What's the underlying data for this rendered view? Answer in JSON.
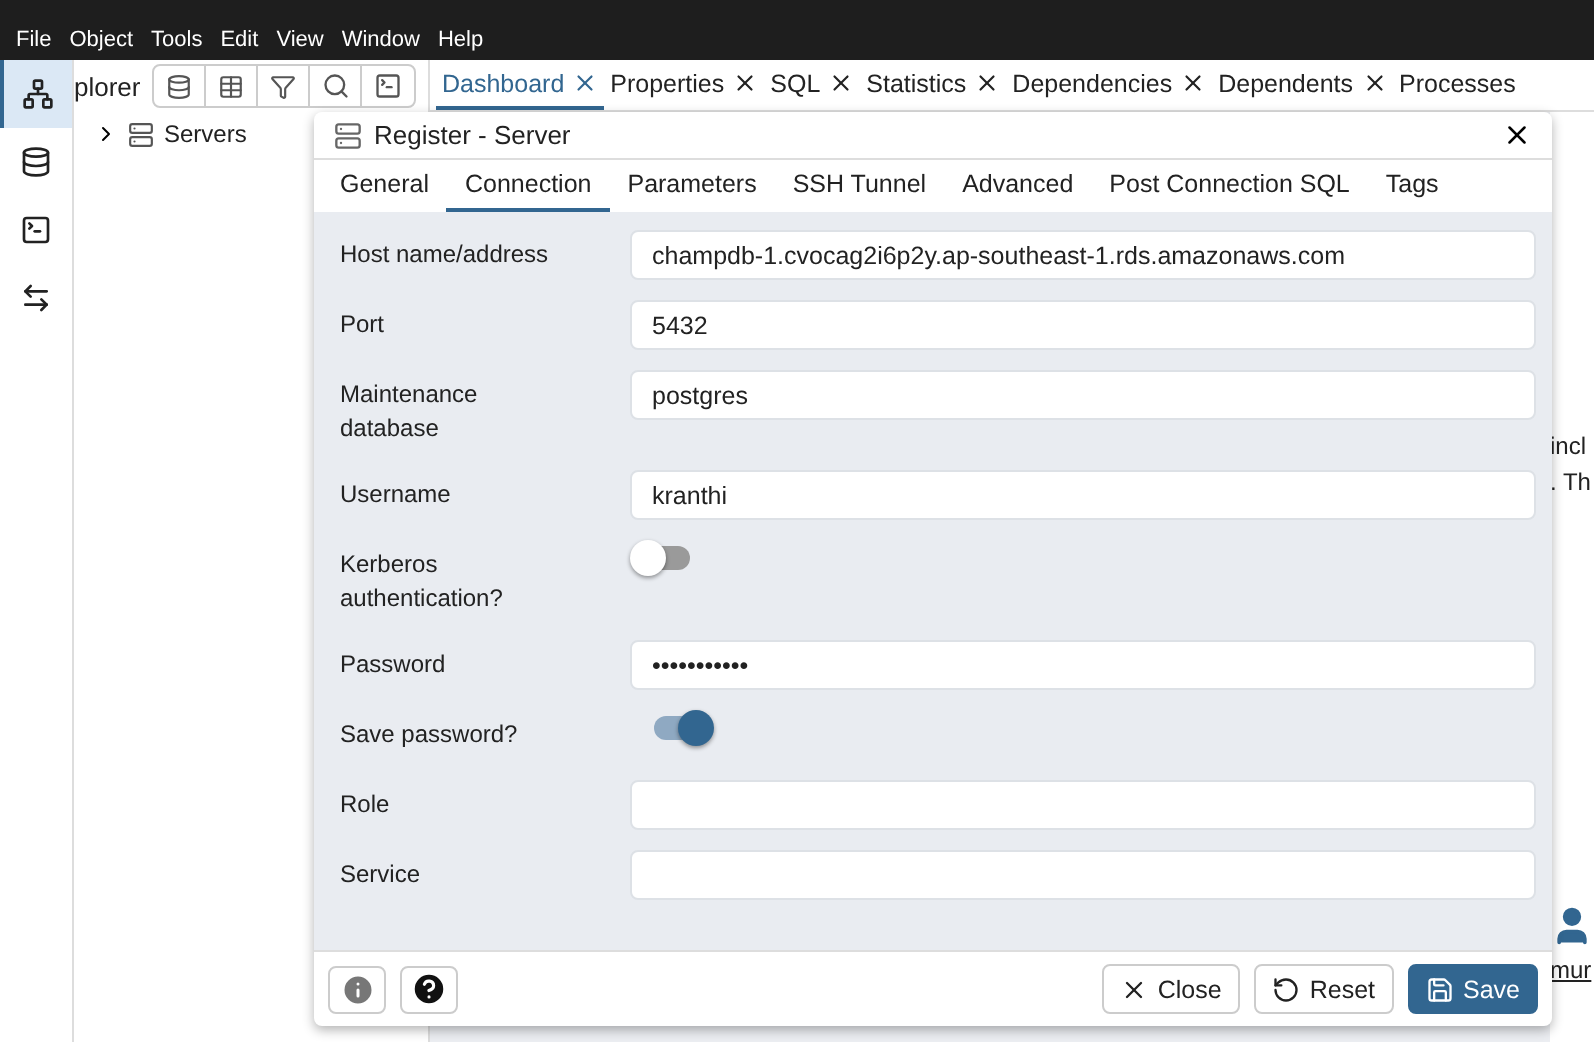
{
  "menu": [
    "File",
    "Object",
    "Tools",
    "Edit",
    "View",
    "Window",
    "Help"
  ],
  "side_tools": [
    {
      "kind": "tree",
      "selected": true
    },
    {
      "kind": "db",
      "selected": false
    },
    {
      "kind": "terminal",
      "selected": false
    },
    {
      "kind": "compare",
      "selected": false
    }
  ],
  "explorer": {
    "title": "plorer",
    "tree": [
      {
        "label": "Servers",
        "expanded": false
      }
    ]
  },
  "main_tabs": [
    {
      "label": "Dashboard",
      "selected": true,
      "closable": true
    },
    {
      "label": "Properties",
      "selected": false,
      "closable": true
    },
    {
      "label": "SQL",
      "selected": false,
      "closable": true
    },
    {
      "label": "Statistics",
      "selected": false,
      "closable": true
    },
    {
      "label": "Dependencies",
      "selected": false,
      "closable": true
    },
    {
      "label": "Dependents",
      "selected": false,
      "closable": true
    },
    {
      "label": "Processes",
      "selected": false,
      "closable": false
    }
  ],
  "background_fragments": [
    "incl",
    ". Th",
    "mur"
  ],
  "dialog": {
    "title": "Register - Server",
    "tabs": [
      {
        "label": "General",
        "selected": false
      },
      {
        "label": "Connection",
        "selected": true
      },
      {
        "label": "Parameters",
        "selected": false
      },
      {
        "label": "SSH Tunnel",
        "selected": false
      },
      {
        "label": "Advanced",
        "selected": false
      },
      {
        "label": "Post Connection SQL",
        "selected": false
      },
      {
        "label": "Tags",
        "selected": false
      }
    ],
    "fields": [
      {
        "kind": "text",
        "label": "Host name/address",
        "value": "champdb-1.cvocag2i6p2y.ap-southeast-1.rds.amazonaws.com"
      },
      {
        "kind": "text",
        "label": "Port",
        "value": "5432"
      },
      {
        "kind": "text",
        "label": "Maintenance database",
        "value": "postgres"
      },
      {
        "kind": "text",
        "label": "Username",
        "value": "kranthi"
      },
      {
        "kind": "toggle",
        "label": "Kerberos authentication?",
        "on": false
      },
      {
        "kind": "text",
        "label": "Password",
        "value": "•••••••••••"
      },
      {
        "kind": "toggle",
        "label": "Save password?",
        "on": true
      },
      {
        "kind": "text",
        "label": "Role"
      },
      {
        "kind": "text",
        "label": "Service"
      }
    ],
    "buttons": [
      {
        "kind": "close",
        "label": "Close"
      },
      {
        "kind": "reset",
        "label": "Reset"
      },
      {
        "kind": "save",
        "label": "Save"
      }
    ]
  }
}
